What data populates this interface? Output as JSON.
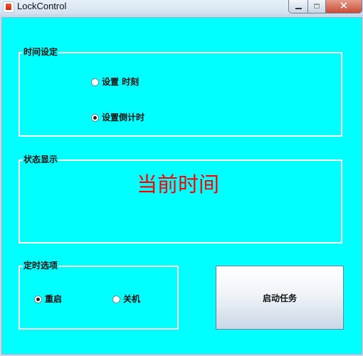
{
  "window": {
    "title": "LockControl",
    "close_glyph": "✕"
  },
  "time_setting": {
    "legend": "时间设定",
    "options": [
      {
        "label": "设置   时刻",
        "checked": false
      },
      {
        "label": "设置倒计时",
        "checked": true
      }
    ]
  },
  "status": {
    "legend": "状态显示",
    "text": "当前时间",
    "text_color": "#ff0000"
  },
  "timer_options": {
    "legend": "定时选项",
    "options": [
      {
        "label": "重启",
        "checked": true
      },
      {
        "label": "关机",
        "checked": false
      }
    ]
  },
  "start_button": {
    "label": "启动任务"
  },
  "colors": {
    "panel_background": "#00ffff",
    "group_border": "#ffffff"
  },
  "icons": {
    "app": "java-cup-icon",
    "minimize": "minimize-icon",
    "maximize": "maximize-icon",
    "close": "close-icon"
  }
}
